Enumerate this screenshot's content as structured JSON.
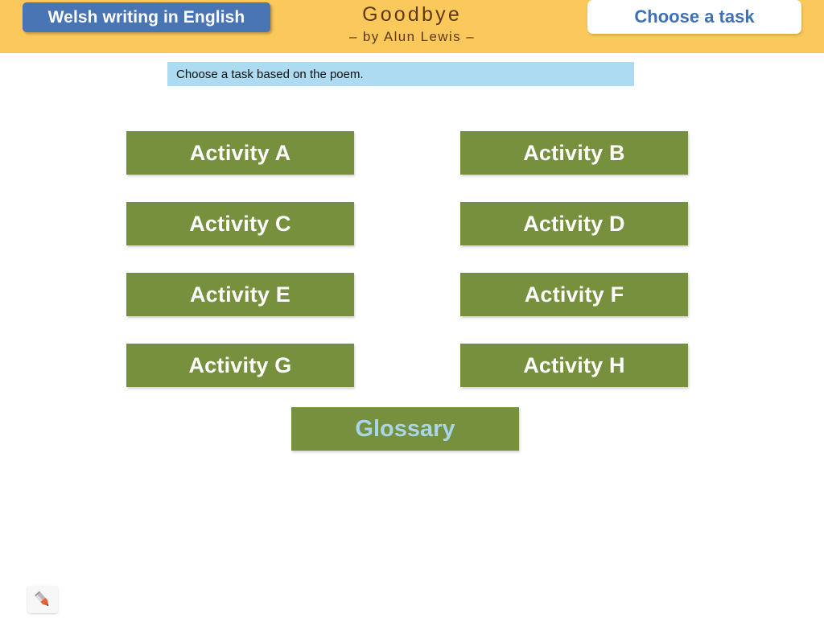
{
  "header": {
    "topic_button_label": "Welsh writing in English",
    "poem_title": "Goodbye",
    "poem_author": "– by Alun Lewis –",
    "choose_task_button_label": "Choose a task",
    "band_color": "#fbc85b",
    "topic_button_color": "#4a75b5",
    "title_color": "#5b3a15",
    "choose_task_text_color": "#3f6fb5"
  },
  "instruction": {
    "text": "Choose a task based on the poem.",
    "background_color": "#addbf1"
  },
  "activities": {
    "button_color": "#76903e",
    "label_color": "#ffffff",
    "items": [
      {
        "label": "Activity A",
        "column": "left",
        "row": 1
      },
      {
        "label": "Activity B",
        "column": "right",
        "row": 1
      },
      {
        "label": "Activity C",
        "column": "left",
        "row": 2
      },
      {
        "label": "Activity D",
        "column": "right",
        "row": 2
      },
      {
        "label": "Activity E",
        "column": "left",
        "row": 3
      },
      {
        "label": "Activity F",
        "column": "right",
        "row": 3
      },
      {
        "label": "Activity G",
        "column": "left",
        "row": 4
      },
      {
        "label": "Activity H",
        "column": "right",
        "row": 4
      }
    ]
  },
  "glossary": {
    "label": "Glossary",
    "button_color": "#76903e",
    "label_color": "#a8d5e8"
  },
  "tools": {
    "pen_icon_name": "pen-icon",
    "pen_tip_color": "#e05a26",
    "pen_body_color": "#9a9a9a"
  }
}
